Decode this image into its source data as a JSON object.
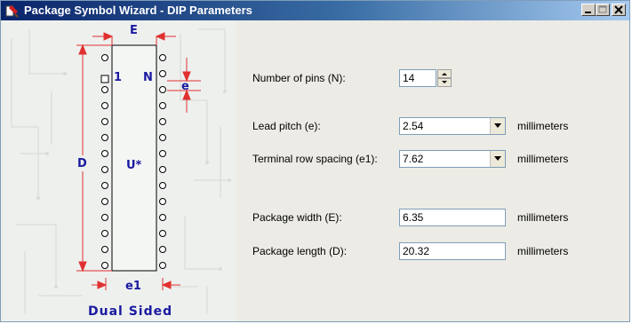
{
  "window": {
    "title": "Package Symbol Wizard - DIP Parameters"
  },
  "icons": {
    "app": "wizard-icon",
    "minimize": "minimize-icon",
    "maximize": "maximize-icon",
    "close": "close-icon"
  },
  "diagram": {
    "width_label": "E",
    "pitch_label": "e",
    "length_label": "D",
    "row_spacing_label": "e1",
    "pin_first": "1",
    "pin_last": "N",
    "designator": "U*",
    "caption": "Dual Sided",
    "pins_per_side": 14
  },
  "form": {
    "pins": {
      "label": "Number of pins (N):",
      "value": "14"
    },
    "lead_pitch": {
      "label": "Lead pitch (e):",
      "value": "2.54",
      "unit": "millimeters"
    },
    "row_spacing": {
      "label": "Terminal row spacing (e1):",
      "value": "7.62",
      "unit": "millimeters"
    },
    "package_width": {
      "label": "Package width (E):",
      "value": "6.35",
      "unit": "millimeters"
    },
    "package_length": {
      "label": "Package length (D):",
      "value": "20.32",
      "unit": "millimeters"
    }
  },
  "colors": {
    "title_start": "#0a246a",
    "title_end": "#a6caf0",
    "dimension": "#e03030",
    "label": "#1a1aa0"
  }
}
